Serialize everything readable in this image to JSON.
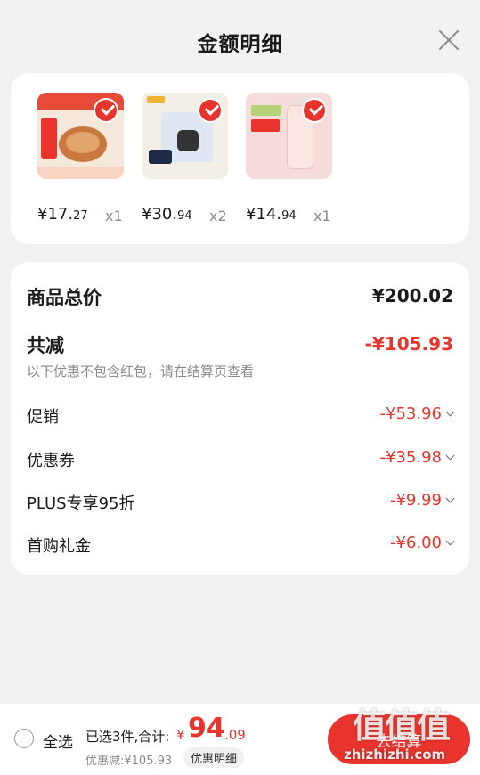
{
  "header": {
    "title": "金额明细"
  },
  "products": [
    {
      "price_int": "¥17.",
      "price_dec": "27",
      "qty": "x1"
    },
    {
      "price_int": "¥30.",
      "price_dec": "94",
      "qty": "x2"
    },
    {
      "price_int": "¥14.",
      "price_dec": "94",
      "qty": "x1"
    }
  ],
  "summary": {
    "total_label": "商品总价",
    "total_value": "¥200.02",
    "reduce_label": "共减",
    "reduce_value": "-¥105.93",
    "note": "以下优惠不包含红包，请在结算页查看",
    "items": [
      {
        "label": "促销",
        "value": "-¥53.96"
      },
      {
        "label": "优惠券",
        "value": "-¥35.98"
      },
      {
        "label": "PLUS专享95折",
        "value": "-¥9.99"
      },
      {
        "label": "首购礼金",
        "value": "-¥6.00"
      }
    ]
  },
  "bottom": {
    "select_all": "全选",
    "selected_summary": "已选3件,合计:",
    "sum_symbol": "¥",
    "sum_int": "94",
    "sum_dec": ".09",
    "discount_text": "优惠减:¥105.93",
    "detail_button": "优惠明细",
    "checkout_button": "去结算"
  },
  "watermark": {
    "url": "zhizhizhi.com"
  },
  "colors": {
    "accent": "#e8342c",
    "muted": "#8a8a8a"
  }
}
